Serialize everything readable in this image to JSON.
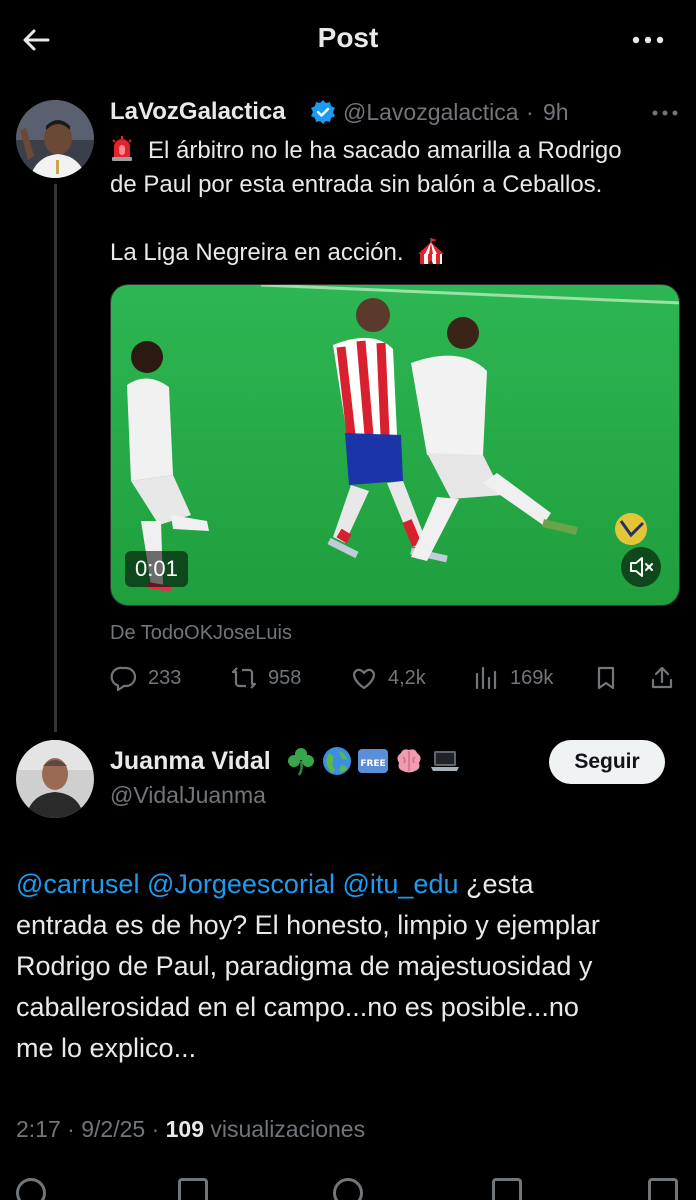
{
  "header": {
    "title": "Post"
  },
  "tweet1": {
    "name": "LaVozGalactica",
    "handle": "@Lavozgalactica",
    "dot": "·",
    "time": "9h",
    "text_line1": "El árbitro no le ha sacado amarilla a Rodrigo",
    "text_line2": "de Paul por esta entrada sin balón a Ceballos.",
    "text_line3": "La Liga Negreira en acción.",
    "video_time": "0:01",
    "from": "De TodoOKJoseLuis",
    "stats": {
      "replies": "233",
      "reposts": "958",
      "likes": "4,2k",
      "views": "169k"
    }
  },
  "tweet2": {
    "name": "Juanma Vidal",
    "emojis": [
      "shamrock",
      "globe",
      "free",
      "brain",
      "laptop"
    ],
    "handle": "@VidalJuanma",
    "follow_label": "Seguir",
    "mention1": "@carrusel",
    "mention2": "@Jorgeescorial",
    "mention3": "@itu_edu",
    "line1_rest": " ¿esta",
    "line2": "entrada es de hoy? El honesto, limpio y ejemplar",
    "line3": "Rodrigo de Paul, paradigma de majestuosidad y",
    "line4": "caballerosidad en el campo...no es posible...no",
    "line5": "me lo explico...",
    "time": "2:17",
    "date": "9/2/25",
    "views_count": "109",
    "views_label": "visualizaciones"
  },
  "colors": {
    "accent": "#1d9bf0",
    "muted": "#71767b",
    "text": "#e7e9ea",
    "background": "#000000"
  }
}
